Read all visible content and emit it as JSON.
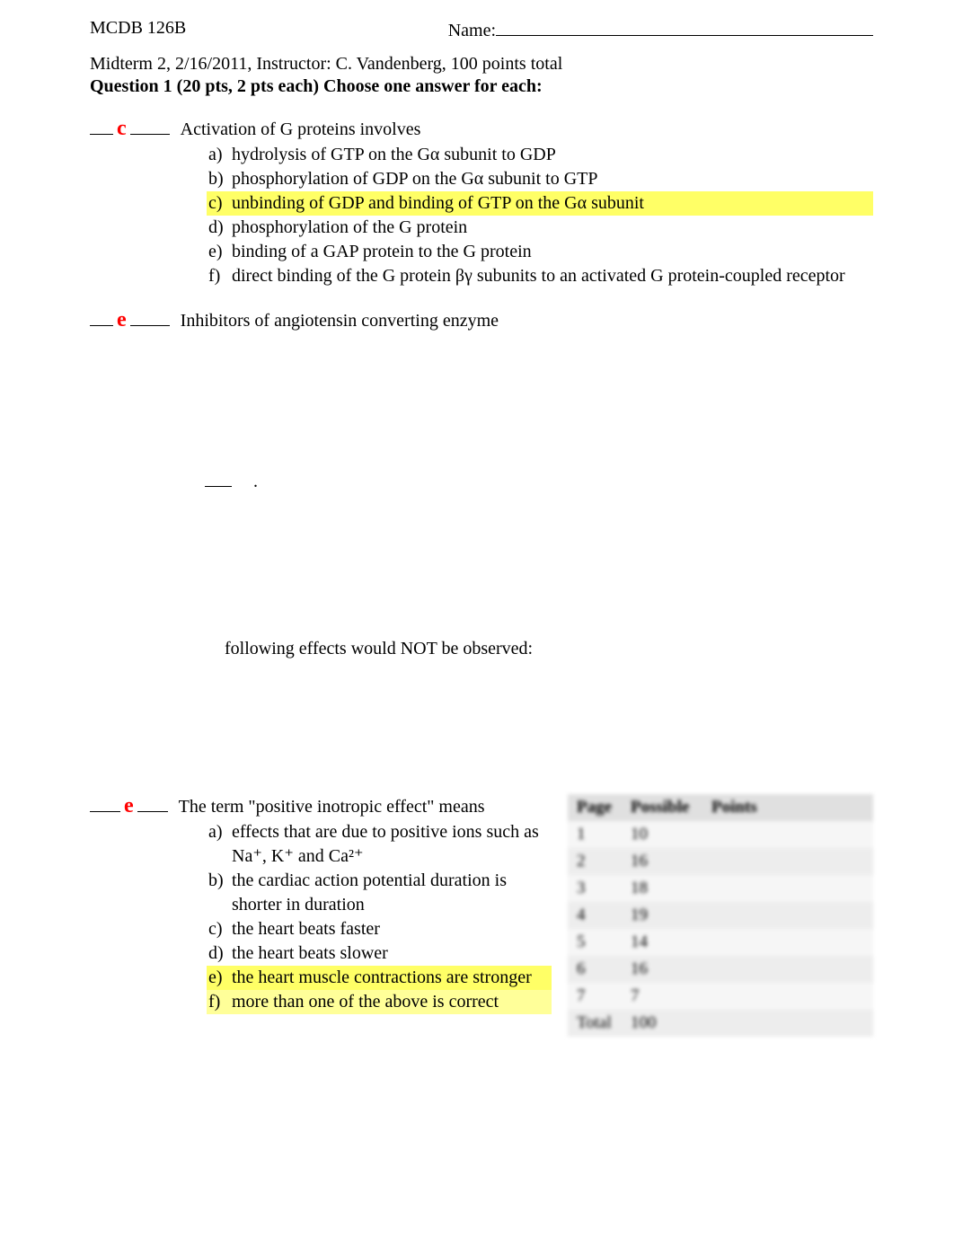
{
  "header": {
    "course": "MCDB 126B",
    "name_label": "Name:"
  },
  "subheader": {
    "line1": "Midterm 2,  2/16/2011, Instructor: C. Vandenberg, 100 points total",
    "line2": "Question 1 (20 pts, 2 pts each) Choose one answer for each:"
  },
  "q1": {
    "answer": "c",
    "stem": "Activation of G proteins involves",
    "opts": {
      "a": "hydrolysis of GTP on the Gα subunit to GDP",
      "b": "phosphorylation of GDP on the Gα subunit to GTP",
      "c": "unbinding of GDP and binding of GTP on the Gα subunit",
      "d": "phosphorylation of the G protein",
      "e": "binding of a GAP protein to the G protein",
      "f": "direct binding of the G protein βγ subunits to an activated G protein-coupled receptor"
    }
  },
  "q2": {
    "answer": "e",
    "stem": "Inhibitors of angiotensin converting enzyme"
  },
  "frag1": ".",
  "q4_frag": "following effects would NOT be observed:",
  "q5": {
    "answer": "e",
    "stem": "The term \"positive inotropic effect\" means",
    "opts": {
      "a": "effects that are due to positive ions such as Na⁺, K⁺ and Ca²⁺",
      "b": "the cardiac action potential duration is shorter in duration",
      "c": "the heart beats faster",
      "d": "the heart beats slower",
      "e": "the heart muscle contractions are stronger",
      "f": "more than one of the above is correct"
    }
  },
  "score": {
    "headers": {
      "page": "Page",
      "possible": "Possible",
      "points": "Points"
    },
    "rows": [
      {
        "page": "1",
        "possible": "10",
        "points": ""
      },
      {
        "page": "2",
        "possible": "16",
        "points": ""
      },
      {
        "page": "3",
        "possible": "18",
        "points": ""
      },
      {
        "page": "4",
        "possible": "19",
        "points": ""
      },
      {
        "page": "5",
        "possible": "14",
        "points": ""
      },
      {
        "page": "6",
        "possible": "16",
        "points": ""
      },
      {
        "page": "7",
        "possible": "7",
        "points": ""
      },
      {
        "page": "Total",
        "possible": "100",
        "points": ""
      }
    ]
  }
}
